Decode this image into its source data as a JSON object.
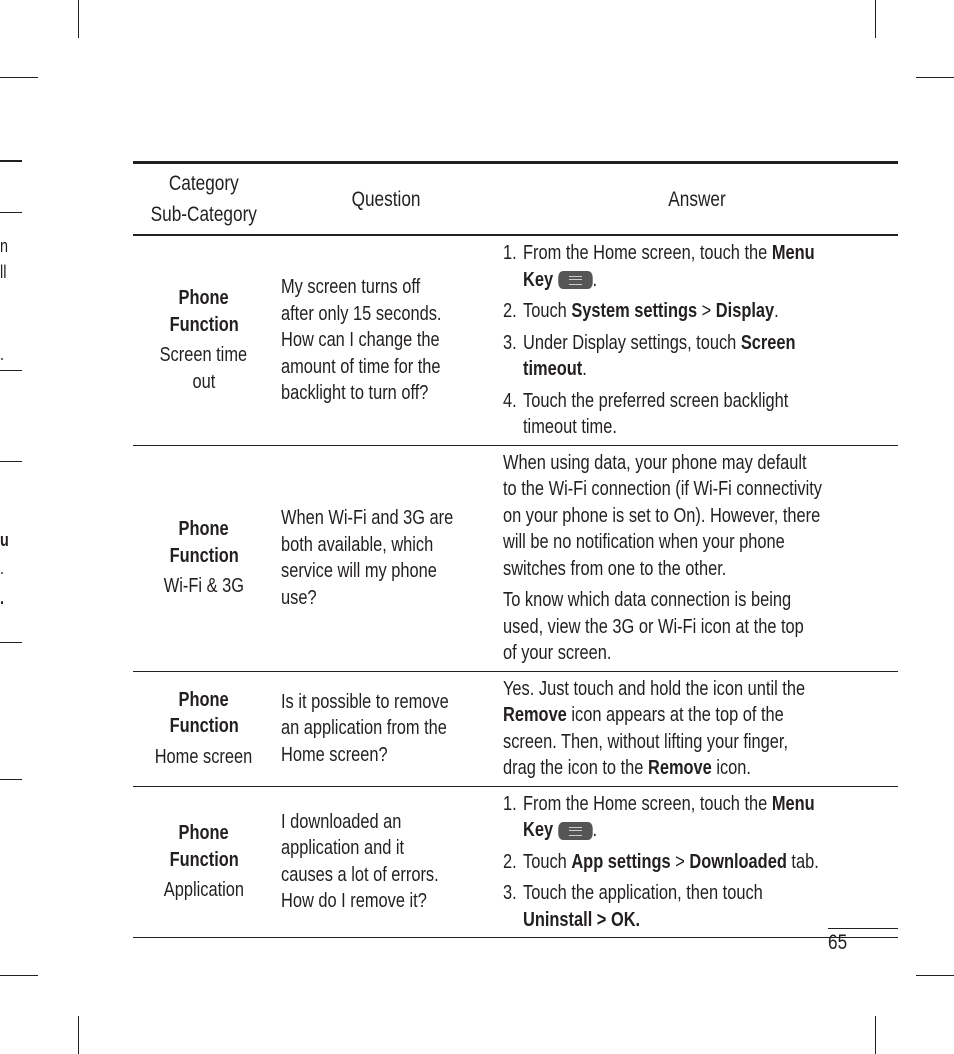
{
  "table": {
    "headers": {
      "category": "Category",
      "subcategory": "Sub-Category",
      "question": "Question",
      "answer": "Answer"
    },
    "rows": [
      {
        "category": "Phone Function",
        "category_l1": "Phone",
        "category_l2": "Function",
        "subcategory_l1": "Screen time",
        "subcategory_l2": "out",
        "question_lines": [
          "My screen turns off",
          "after only 15 seconds.",
          "How can I change the",
          "amount of time for the",
          "backlight to turn off?"
        ],
        "answer_steps": [
          {
            "num": "1.",
            "l1_pre": "From the Home screen, touch the ",
            "l1_bold": "Menu",
            "l2_bold": "Key",
            "l2_post": "."
          },
          {
            "num": "2.",
            "pre": "Touch ",
            "b1": "System settings",
            "mid": " > ",
            "b2": "Display",
            "post": "."
          },
          {
            "num": "3.",
            "l1_pre": "Under Display settings, touch ",
            "l1_bold": "Screen",
            "l2_bold": "timeout",
            "l2_post": "."
          },
          {
            "num": "4.",
            "l1": "Touch the preferred screen backlight",
            "l2": "timeout time."
          }
        ]
      },
      {
        "category": "Phone Function",
        "category_l1": "Phone",
        "category_l2": "Function",
        "subcategory_l1": "Wi-Fi & 3G",
        "question_lines": [
          "When Wi-Fi and 3G are",
          "both available, which",
          "service will my phone",
          "use?"
        ],
        "answer_para1": [
          "When using data, your phone may default",
          "to the Wi-Fi connection (if Wi-Fi connectivity",
          "on your phone is set to On). However, there",
          "will be no notification when your phone",
          "switches from one to the other."
        ],
        "answer_para2": [
          "To know which data connection is being",
          "used, view the 3G or Wi-Fi icon at the top",
          "of your screen."
        ]
      },
      {
        "category": "Phone Function",
        "category_l1": "Phone",
        "category_l2": "Function",
        "subcategory_l1": "Home screen",
        "question_lines": [
          "Is it possible to remove",
          "an application from the",
          "Home screen?"
        ],
        "answer": {
          "l1": "Yes. Just touch and hold the icon until the",
          "l2_bold": "Remove",
          "l2_post": " icon appears at the top of the",
          "l3": "screen. Then, without lifting your finger,",
          "l4_pre": "drag the icon to the ",
          "l4_bold": "Remove",
          "l4_post": " icon."
        }
      },
      {
        "category": "Phone Function",
        "category_l1": "Phone",
        "category_l2": "Function",
        "subcategory_l1": "Application",
        "question_lines": [
          "I downloaded an",
          "application and it",
          "causes a lot of errors.",
          "How do I remove it?"
        ],
        "answer_steps": [
          {
            "num": "1.",
            "l1_pre": "From the Home screen, touch the ",
            "l1_bold": "Menu",
            "l2_bold": "Key",
            "l2_post": "."
          },
          {
            "num": "2.",
            "pre": "Touch ",
            "b1": "App settings",
            "mid": " > ",
            "b2": "Downloaded",
            "post": " tab."
          },
          {
            "num": "3.",
            "l1": "Touch the application, then touch",
            "l2_bold": "Uninstall > OK."
          }
        ]
      }
    ]
  },
  "page_number": "65",
  "edge_fragments": [
    "n",
    "ll",
    ".",
    "u",
    ".",
    "."
  ]
}
